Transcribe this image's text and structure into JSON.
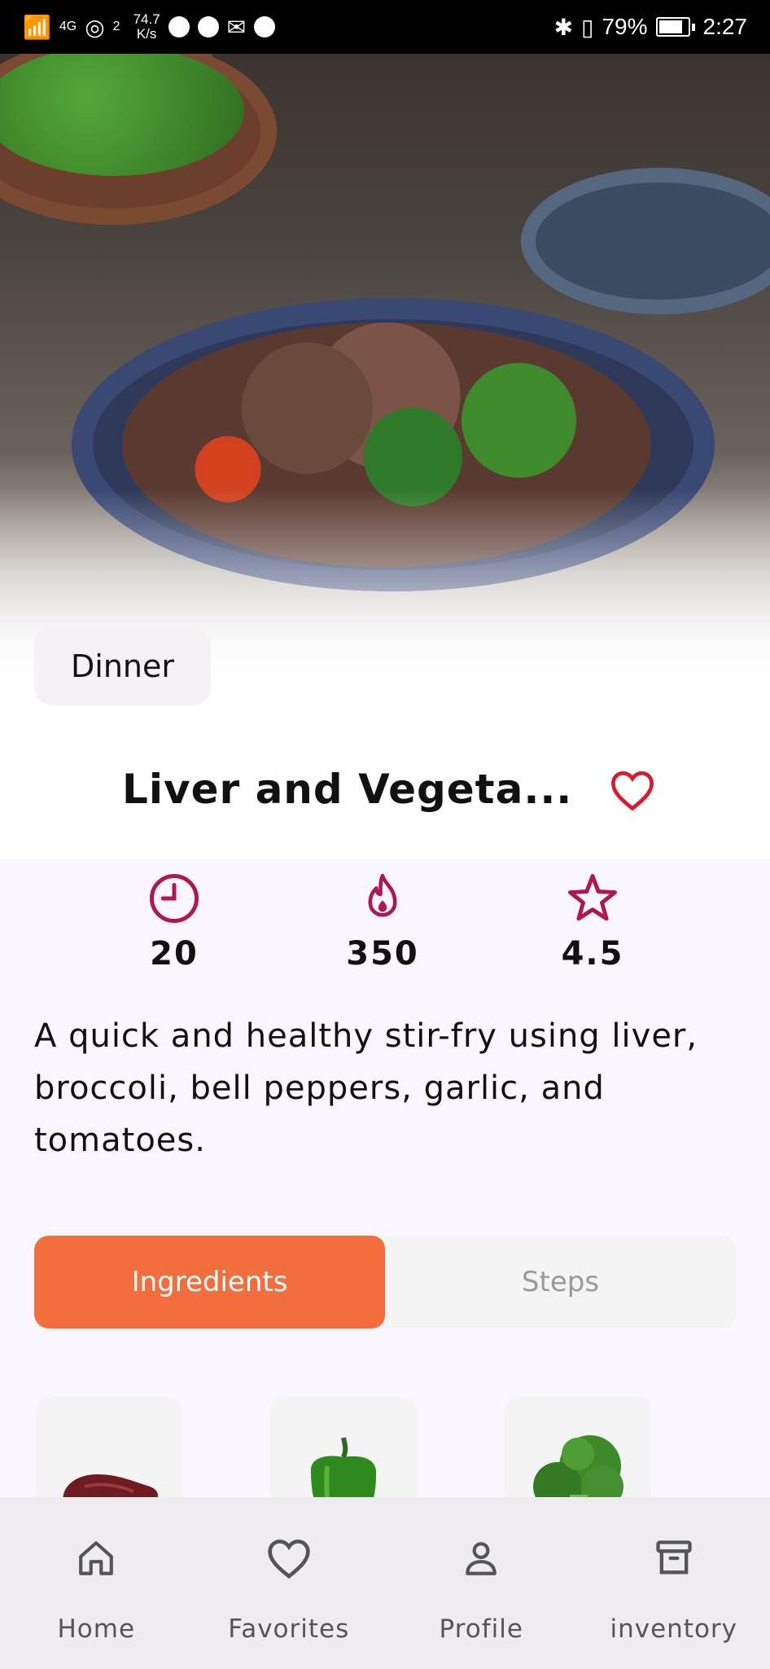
{
  "status_bar": {
    "net_speed_value": "74.7",
    "net_speed_unit": "K/s",
    "network": "4G",
    "hotspot_count": "2",
    "battery": "79%",
    "time": "2:27"
  },
  "recipe": {
    "category": "Dinner",
    "title": "Liver and Vegeta...",
    "stats": {
      "time": "20",
      "calories": "350",
      "rating": "4.5"
    },
    "description": "A quick and healthy stir-fry using liver, broccoli, bell peppers, garlic, and tomatoes."
  },
  "tabs": [
    {
      "label": "Ingredients",
      "active": true
    },
    {
      "label": "Steps",
      "active": false
    }
  ],
  "ingredients": [
    {
      "name": "liver"
    },
    {
      "name": "bell pepper"
    },
    {
      "name": "broccoli"
    }
  ],
  "nav": [
    {
      "label": "Home",
      "icon": "home-icon"
    },
    {
      "label": "Favorites",
      "icon": "heart-icon"
    },
    {
      "label": "Profile",
      "icon": "user-icon"
    },
    {
      "label": "inventory",
      "icon": "archive-icon"
    }
  ],
  "colors": {
    "accent": "#f26e3c",
    "icon_primary": "#b0174f",
    "favorite": "#d81b2d"
  }
}
